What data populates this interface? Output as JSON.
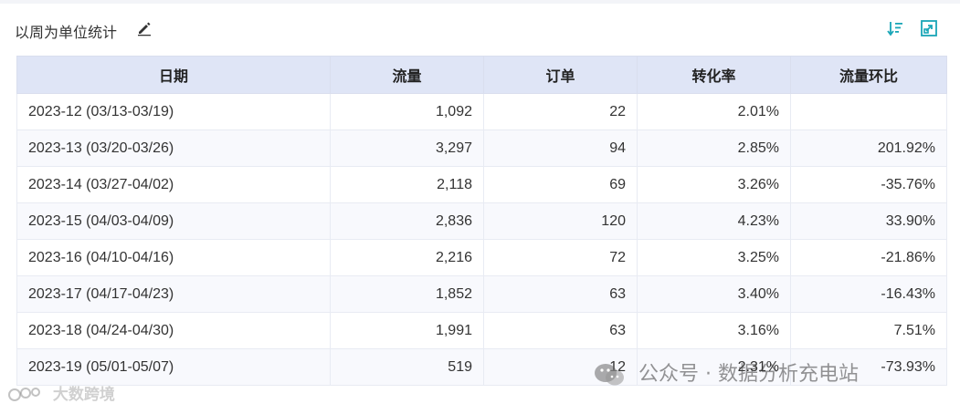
{
  "header": {
    "title": "以周为单位统计"
  },
  "table": {
    "columns": [
      "日期",
      "流量",
      "订单",
      "转化率",
      "流量环比"
    ],
    "rows": [
      [
        "2023-12 (03/13-03/19)",
        "1,092",
        "22",
        "2.01%",
        ""
      ],
      [
        "2023-13 (03/20-03/26)",
        "3,297",
        "94",
        "2.85%",
        "201.92%"
      ],
      [
        "2023-14 (03/27-04/02)",
        "2,118",
        "69",
        "3.26%",
        "-35.76%"
      ],
      [
        "2023-15 (04/03-04/09)",
        "2,836",
        "120",
        "4.23%",
        "33.90%"
      ],
      [
        "2023-16 (04/10-04/16)",
        "2,216",
        "72",
        "3.25%",
        "-21.86%"
      ],
      [
        "2023-17 (04/17-04/23)",
        "1,852",
        "63",
        "3.40%",
        "-16.43%"
      ],
      [
        "2023-18 (04/24-04/30)",
        "1,991",
        "63",
        "3.16%",
        "7.51%"
      ],
      [
        "2023-19 (05/01-05/07)",
        "519",
        "12",
        "2.31%",
        "-73.93%"
      ]
    ]
  },
  "watermarks": {
    "left": "大数跨境",
    "right": "公众号 · 数据分析充电站"
  },
  "colors": {
    "header_bg": "#dfe5f6",
    "icon_accent": "#1aa6b7",
    "row_alt_bg": "#f8f9fd"
  },
  "icons": {
    "edit": "pen-icon",
    "sort": "sort-descending-icon",
    "expand": "expand-icon"
  }
}
